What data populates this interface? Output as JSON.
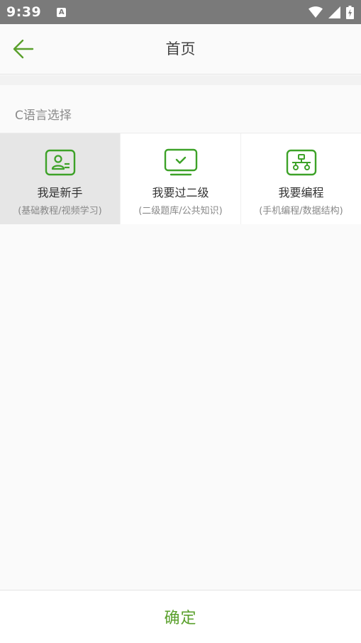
{
  "status": {
    "time": "9:39",
    "notification_letter": "A"
  },
  "header": {
    "title": "首页"
  },
  "section": {
    "title": "C语言选择"
  },
  "options": [
    {
      "title": "我是新手",
      "subtitle": "(基础教程/视频学习)",
      "icon": "user-card-icon",
      "selected": true
    },
    {
      "title": "我要过二级",
      "subtitle": "(二级题库/公共知识)",
      "icon": "monitor-check-icon",
      "selected": false
    },
    {
      "title": "我要编程",
      "subtitle": "(手机编程/数据结构)",
      "icon": "network-icon",
      "selected": false
    }
  ],
  "footer": {
    "confirm_label": "确定"
  },
  "colors": {
    "accent": "#5aa02c",
    "icon_green": "#3da228",
    "status_bar": "#7a7a7a",
    "selected_bg": "#e6e6e6"
  }
}
